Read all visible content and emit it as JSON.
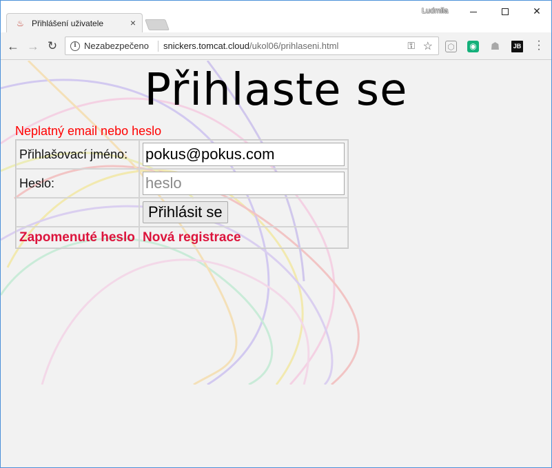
{
  "browser": {
    "tab_title": "Přihlášení uživatele",
    "tab_close": "×",
    "user_name": "Ludmila",
    "security_label": "Nezabezpečeno",
    "url_host": "snickers.tomcat.cloud",
    "url_path": "/ukol06/prihlaseni.html",
    "ext_jb_label": "JB"
  },
  "page": {
    "heading": "Přihlaste se",
    "error_message": "Neplatný email nebo heslo",
    "username_label": "Přihlašovací jméno:",
    "username_value": "pokus@pokus.com",
    "password_label": "Heslo:",
    "password_placeholder": "heslo",
    "submit_label": "Přihlásit se",
    "forgot_link": "Zapomenuté heslo",
    "register_link": "Nová registrace"
  },
  "colors": {
    "error": "#ff0000",
    "link": "#dc143c"
  }
}
